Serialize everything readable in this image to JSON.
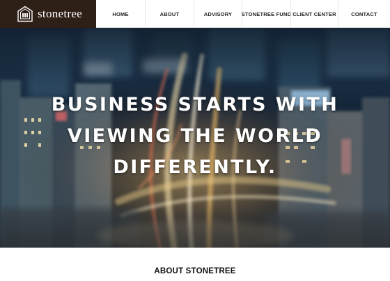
{
  "brand": {
    "name": "stonetree",
    "logo_icon": "house-emblem-icon"
  },
  "nav": {
    "items": [
      {
        "label": "HOME"
      },
      {
        "label": "ABOUT"
      },
      {
        "label": "ADVISORY"
      },
      {
        "label": "STONETREE FUND"
      },
      {
        "label": "CLIENT CENTER"
      },
      {
        "label": "CONTACT"
      }
    ]
  },
  "hero": {
    "lines": [
      "BUSINESS STARTS WITH",
      "VIEWING THE WORLD",
      "DIFFERENTLY."
    ],
    "background": "night-city-highway-photo"
  },
  "about": {
    "title": "ABOUT STONETREE"
  },
  "colors": {
    "brand_bg": "#2e1f17",
    "nav_text": "#222222",
    "hero_text": "#ffffff"
  }
}
